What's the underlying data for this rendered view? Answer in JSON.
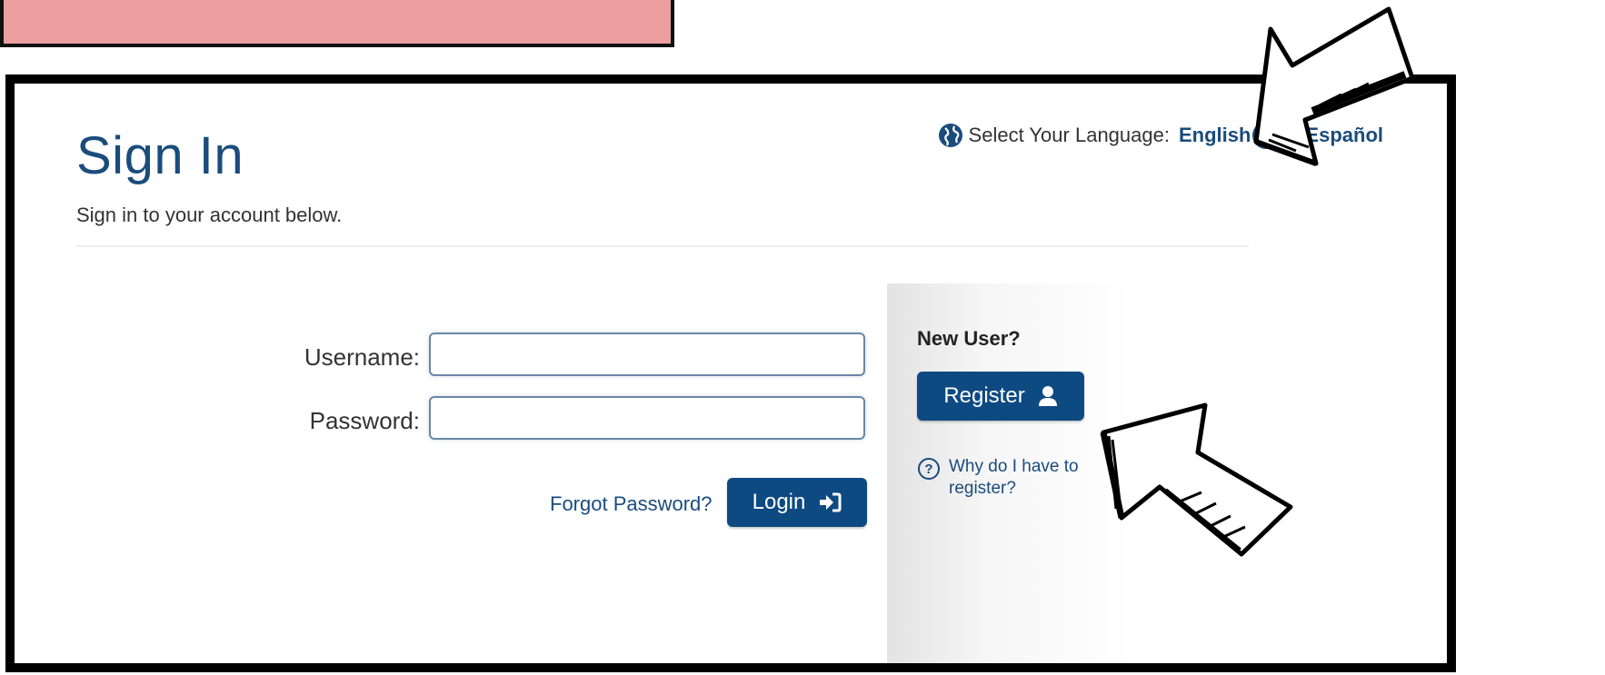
{
  "page": {
    "title": "Sign In",
    "subtitle": "Sign in to your account below."
  },
  "language": {
    "label": "Select Your Language:",
    "option_left": "English",
    "option_right": "Español",
    "toggle_state": "right"
  },
  "form": {
    "username_label": "Username:",
    "password_label": "Password:",
    "username_value": "",
    "password_value": "",
    "forgot_link": "Forgot Password?",
    "login_button": "Login"
  },
  "register": {
    "heading": "New User?",
    "button": "Register",
    "help_text": "Why do I have to register?"
  },
  "colors": {
    "brand": "#1a4c7c",
    "button": "#0e4a82",
    "banner": "#eba09f"
  },
  "icons": {
    "globe": "globe-icon",
    "user": "user-icon",
    "login": "sign-in-icon",
    "help": "question-circle-icon"
  }
}
